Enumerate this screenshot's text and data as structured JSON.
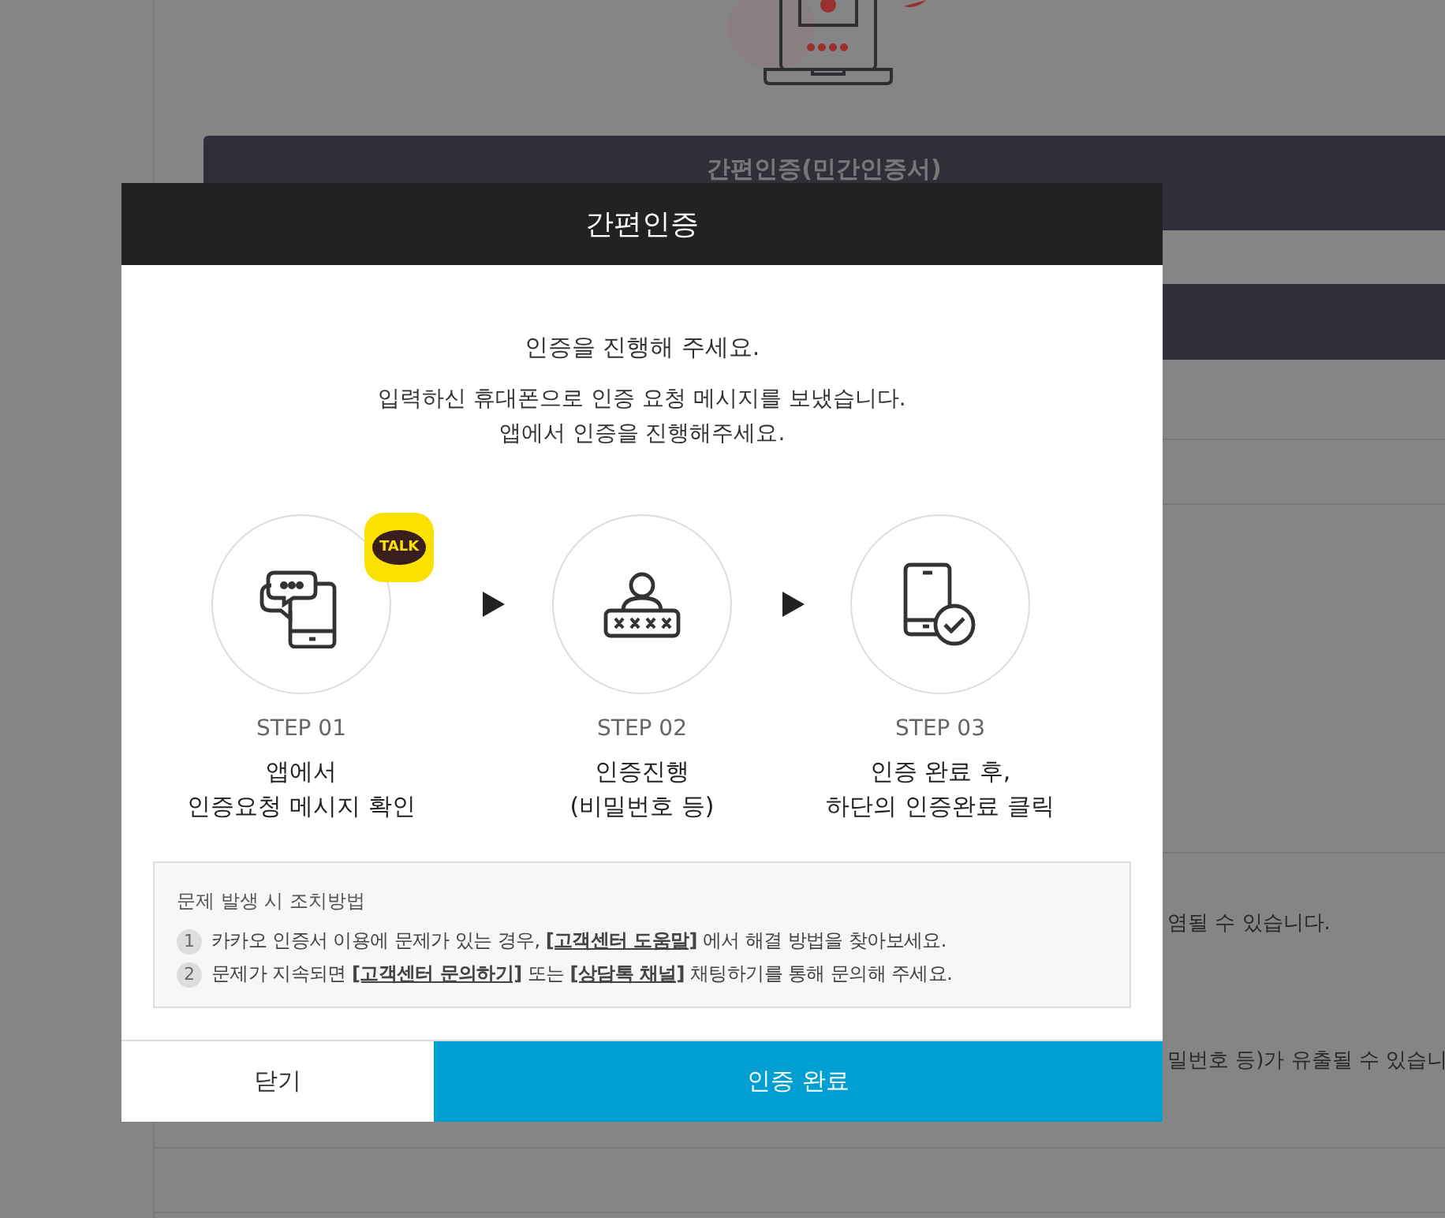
{
  "background": {
    "banner_title": "간편인증(민간인증서)",
    "notes": [
      "염될 수 있습니다.",
      "밀번호 등)가 유출될 수 있습니"
    ]
  },
  "dialog": {
    "title": "간편인증",
    "heading": "인증을 진행해 주세요.",
    "message_lines": [
      "입력하신 휴대폰으로 인증 요청 메시지를 보냈습니다.",
      "앱에서 인증을 진행해주세요."
    ],
    "app_badge": "TALK",
    "steps": [
      {
        "kind": "message",
        "label": "STEP 01",
        "lines": [
          "앱에서",
          "인증요청 메시지 확인"
        ]
      },
      {
        "kind": "password",
        "label": "STEP 02",
        "lines": [
          "인증진행",
          "(비밀번호 등)"
        ]
      },
      {
        "kind": "done",
        "label": "STEP 03",
        "lines": [
          "인증 완료 후,",
          "하단의 인증완료 클릭"
        ]
      }
    ],
    "help": {
      "title": "문제 발생 시 조치방법",
      "items": [
        {
          "number": "1",
          "parts": [
            {
              "kind": "text",
              "text": "카카오 인증서 이용에 문제가 있는 경우, "
            },
            {
              "kind": "link",
              "text": "[고객센터 도움말]"
            },
            {
              "kind": "text",
              "text": " 에서 해결 방법을 찾아보세요."
            }
          ]
        },
        {
          "number": "2",
          "parts": [
            {
              "kind": "text",
              "text": "문제가 지속되면 "
            },
            {
              "kind": "link",
              "text": "[고객센터 문의하기]"
            },
            {
              "kind": "text",
              "text": " 또는 "
            },
            {
              "kind": "link",
              "text": "[상담톡 채널]"
            },
            {
              "kind": "text",
              "text": " 채팅하기를 통해 문의해 주세요."
            }
          ]
        }
      ]
    },
    "buttons": [
      {
        "kind": "secondary",
        "label": "닫기"
      },
      {
        "kind": "primary",
        "label": "인증 완료"
      }
    ]
  }
}
